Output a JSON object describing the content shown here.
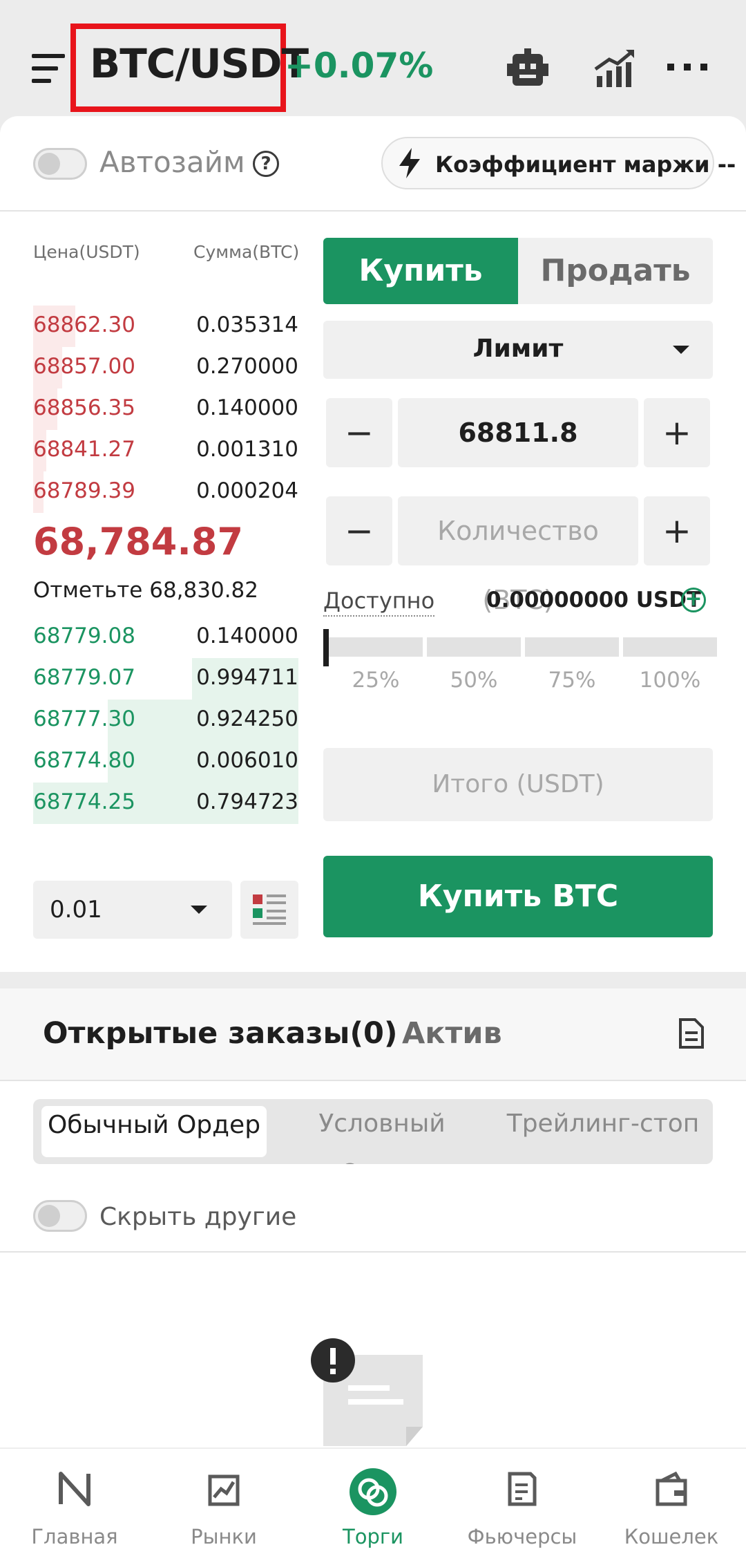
{
  "header": {
    "pair": "BTC/USDT",
    "change": "+0.07%"
  },
  "controls": {
    "autoloan_label": "Автозайм",
    "help_glyph": "?",
    "margin_label": "Коэффициент маржи --"
  },
  "orderbook": {
    "price_header": "Цена(USDT)",
    "amount_header": "Сумма(BTC)",
    "asks": [
      {
        "price": "68862.30",
        "amount": "0.035314",
        "depth": 0.16
      },
      {
        "price": "68857.00",
        "amount": "0.270000",
        "depth": 0.11
      },
      {
        "price": "68856.35",
        "amount": "0.140000",
        "depth": 0.09
      },
      {
        "price": "68841.27",
        "amount": "0.001310",
        "depth": 0.05
      },
      {
        "price": "68789.39",
        "amount": "0.000204",
        "depth": 0.04
      }
    ],
    "last_price": "68,784.87",
    "mark_price": "Отметьте 68,830.82",
    "bids": [
      {
        "price": "68779.08",
        "amount": "0.140000",
        "depth": 0.0
      },
      {
        "price": "68779.07",
        "amount": "0.994711",
        "depth": 0.4
      },
      {
        "price": "68777.30",
        "amount": "0.924250",
        "depth": 0.72
      },
      {
        "price": "68774.80",
        "amount": "0.006010",
        "depth": 0.72
      },
      {
        "price": "68774.25",
        "amount": "0.794723",
        "depth": 1.0
      }
    ],
    "precision": "0.01"
  },
  "order_form": {
    "buy_tab": "Купить",
    "sell_tab": "Продать",
    "order_type": "Лимит",
    "minus": "−",
    "plus": "+",
    "price_value": "68811.8",
    "quantity_placeholder": "Количество (BTC)",
    "available_label": "Доступно",
    "available_value": "0.00000000 USDT",
    "plus_circle": "+",
    "slider_steps": [
      "25%",
      "50%",
      "75%",
      "100%"
    ],
    "total_placeholder": "Итого (USDT)",
    "buy_button": "Купить BTC"
  },
  "orders": {
    "tab_open": "Открытые заказы(0)",
    "tab_assets": "Актив",
    "segments": [
      "Обычный Ордер",
      "Условный Ордер",
      "Трейлинг-стоп"
    ],
    "hide_others": "Скрыть другие"
  },
  "bottom_nav": [
    {
      "label": "Главная",
      "icon": "home-icon"
    },
    {
      "label": "Рынки",
      "icon": "markets-icon"
    },
    {
      "label": "Торги",
      "icon": "trade-icon"
    },
    {
      "label": "Фьючерсы",
      "icon": "futures-icon"
    },
    {
      "label": "Кошелек",
      "icon": "wallet-icon"
    }
  ],
  "colors": {
    "brand_green": "#1b9461",
    "ask_red": "#c23b41",
    "highlight_red": "#e8141b"
  }
}
